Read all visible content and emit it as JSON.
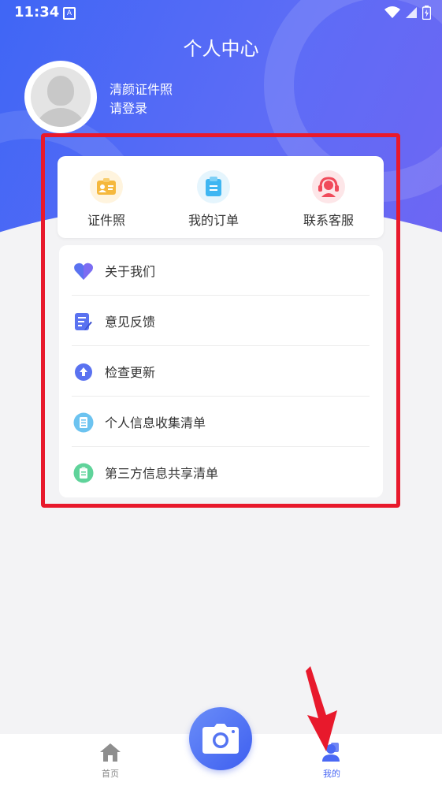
{
  "status_bar": {
    "time": "11:34",
    "notification_letter": "A"
  },
  "header": {
    "title": "个人中心"
  },
  "user": {
    "name": "清颜证件照",
    "login_prompt": "请登录"
  },
  "quick_actions": [
    {
      "label": "证件照",
      "icon": "id-card-icon",
      "color": "#f5b83d"
    },
    {
      "label": "我的订单",
      "icon": "order-clipboard-icon",
      "color": "#3fb6f2"
    },
    {
      "label": "联系客服",
      "icon": "customer-service-icon",
      "color": "#f04a5a"
    }
  ],
  "menu": [
    {
      "label": "关于我们",
      "icon": "heart-icon"
    },
    {
      "label": "意见反馈",
      "icon": "feedback-icon"
    },
    {
      "label": "检查更新",
      "icon": "update-arrow-icon"
    },
    {
      "label": "个人信息收集清单",
      "icon": "document-list-icon"
    },
    {
      "label": "第三方信息共享清单",
      "icon": "clipboard-list-icon"
    }
  ],
  "tab_bar": {
    "home_label": "首页",
    "camera_icon": "camera-icon",
    "mine_label": "我的",
    "active": "我的"
  },
  "colors": {
    "accent": "#4a68f4",
    "highlight": "#e8192c"
  }
}
